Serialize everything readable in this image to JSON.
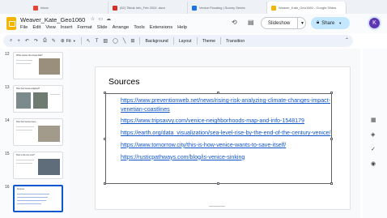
{
  "browser": {
    "tabs": [
      {
        "title": "Inbox"
      },
      {
        "title": "(62) Tiktok Info_Feb 2024 .docx",
        "color": "#d93025"
      },
      {
        "title": "Venice Flooding | Survey Series",
        "color": "#1a73e8"
      },
      {
        "title": "Weaver_Kate_Geo1060 - Google Slides",
        "color": "#f4b400"
      }
    ]
  },
  "app": {
    "doc_title": "Weaver_Kate_Geo1060",
    "menu": [
      "File",
      "Edit",
      "View",
      "Insert",
      "Format",
      "Slide",
      "Arrange",
      "Tools",
      "Extensions",
      "Help"
    ],
    "slideshow_label": "Slideshow",
    "share_label": "Share",
    "avatar_initial": "K",
    "accent": "#0b57d0",
    "share_bg": "#c2e7ff"
  },
  "toolbar": {
    "zoom": "Fit",
    "background": "Background",
    "layout": "Layout",
    "theme": "Theme",
    "transition": "Transition"
  },
  "filmstrip": {
    "slides": [
      {
        "number": "12",
        "title": "What causes the Acqua Alta?"
      },
      {
        "number": "13",
        "title": "How has Venice adapted?"
      },
      {
        "number": "14",
        "title": "How has Venice been..."
      },
      {
        "number": "15",
        "title": "How is the city now?"
      },
      {
        "number": "16",
        "title": "Sources",
        "selected": true
      }
    ]
  },
  "slide": {
    "title": "Sources",
    "sources": [
      "https://www.preventionweb.net/news/rising-risk-analyzing-climate-changes-impact-venetian-coastlines",
      "https://www.tripsavvy.com/venice-neighborhoods-map-and-info-1548179",
      "https://earth.org/data_visualization/sea-level-rise-by-the-end-of-the-century-venice/",
      "https://www.tomorrow.city/this-is-how-venice-wants-to-save-itself/",
      "https://rusticpathways.com/blog/is-venice-sinking"
    ]
  }
}
